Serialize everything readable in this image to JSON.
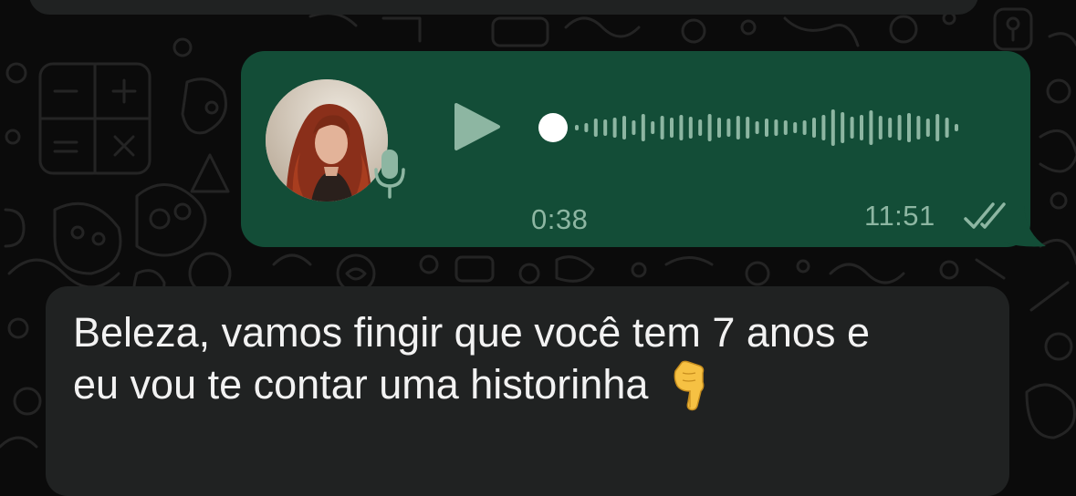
{
  "chat": {
    "voice_message": {
      "duration": "0:38",
      "time": "11:51",
      "status": "read",
      "play_icon": "play-icon",
      "mic_icon": "microphone-icon",
      "ticks_icon": "double-check-icon",
      "bubble_color": "#134d37",
      "played_fraction": 0
    },
    "incoming_message": {
      "line1": "Beleza, vamos fingir que você tem 7 anos e",
      "line2": "eu vou te contar uma historinha",
      "emoji": "👇",
      "bubble_color": "#202222"
    }
  }
}
